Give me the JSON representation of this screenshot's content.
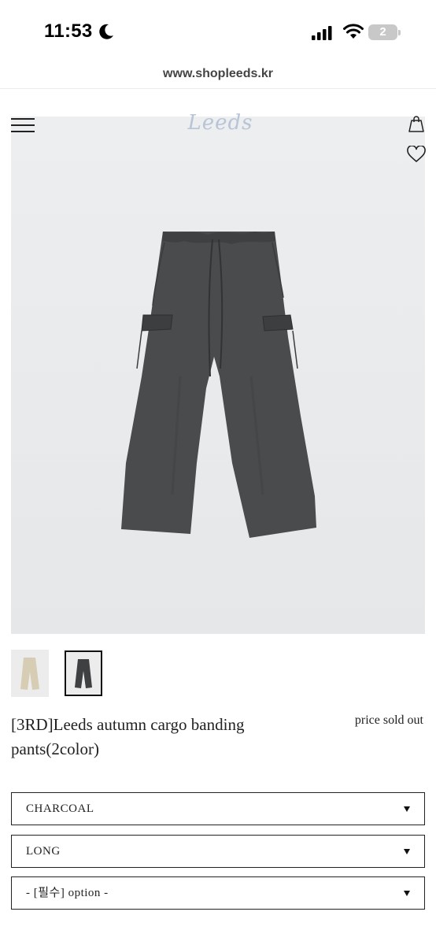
{
  "status_bar": {
    "time": "11:53",
    "battery_level": "2"
  },
  "browser": {
    "url": "www.shopleeds.kr"
  },
  "header": {
    "logo_text": "Leeds"
  },
  "product": {
    "title": "[3RD]Leeds autumn cargo banding pants(2color)",
    "price": "price sold out",
    "thumbnail_count": 2,
    "selected_thumbnail": 2
  },
  "options": {
    "color": "CHARCOAL",
    "length": "LONG",
    "option": "- [필수] option -"
  },
  "colors": {
    "hero_background": "#e9eaec",
    "pants_charcoal": "#4a4b4c",
    "pants_beige": "#d6cdb4",
    "logo": "#b9c4d6"
  },
  "icons": [
    "moon-icon",
    "signal-icon",
    "wifi-icon",
    "battery-icon",
    "menu-icon",
    "shopping-bag-icon",
    "heart-icon",
    "chevron-down-icon"
  ]
}
